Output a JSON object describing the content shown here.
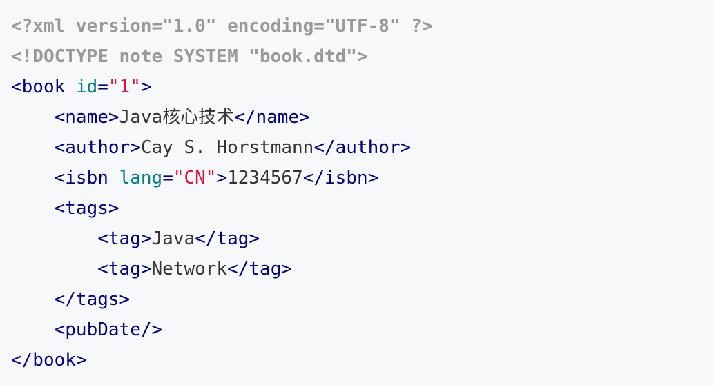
{
  "code": {
    "xml_declaration": "<?xml version=\"1.0\" encoding=\"UTF-8\" ?>",
    "doctype": "<!DOCTYPE note SYSTEM \"book.dtd\">",
    "book_open": "<book",
    "book_id_attr": "id",
    "book_id_value": "\"1\"",
    "book_close_bracket": ">",
    "name_open": "<name>",
    "name_text": "Java核心技术",
    "name_close": "</name>",
    "author_open": "<author>",
    "author_text": "Cay S. Horstmann",
    "author_close": "</author>",
    "isbn_open": "<isbn",
    "isbn_lang_attr": "lang",
    "isbn_lang_value": "\"CN\"",
    "isbn_bracket": ">",
    "isbn_text": "1234567",
    "isbn_close": "</isbn>",
    "tags_open": "<tags>",
    "tag1_open": "<tag>",
    "tag1_text": "Java",
    "tag1_close": "</tag>",
    "tag2_open": "<tag>",
    "tag2_text": "Network",
    "tag2_close": "</tag>",
    "tags_close": "</tags>",
    "pubdate": "<pubDate/>",
    "book_close": "</book>"
  },
  "colors": {
    "background": "#f7f8fa",
    "meta": "#999999",
    "tag": "#000080",
    "attribute": "#008080",
    "string": "#dd1144",
    "text": "#333333"
  }
}
